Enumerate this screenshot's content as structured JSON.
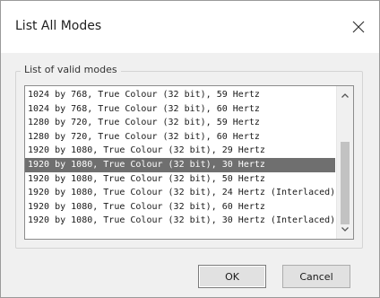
{
  "window": {
    "title": "List All Modes",
    "close_glyph": "✕"
  },
  "group": {
    "label": "List of valid modes"
  },
  "modes": [
    {
      "label": "1024 by 768, True Colour (32 bit), 59 Hertz",
      "selected": false
    },
    {
      "label": "1024 by 768, True Colour (32 bit), 60 Hertz",
      "selected": false
    },
    {
      "label": "1280 by 720, True Colour (32 bit), 59 Hertz",
      "selected": false
    },
    {
      "label": "1280 by 720, True Colour (32 bit), 60 Hertz",
      "selected": false
    },
    {
      "label": "1920 by 1080, True Colour (32 bit), 29 Hertz",
      "selected": false
    },
    {
      "label": "1920 by 1080, True Colour (32 bit), 30 Hertz",
      "selected": true
    },
    {
      "label": "1920 by 1080, True Colour (32 bit), 50 Hertz",
      "selected": false
    },
    {
      "label": "1920 by 1080, True Colour (32 bit), 24 Hertz (Interlaced)",
      "selected": false
    },
    {
      "label": "1920 by 1080, True Colour (32 bit), 60 Hertz",
      "selected": false
    },
    {
      "label": "1920 by 1080, True Colour (32 bit), 30 Hertz (Interlaced)",
      "selected": false
    }
  ],
  "buttons": {
    "ok": "OK",
    "cancel": "Cancel"
  },
  "colors": {
    "selection": "#6f6f6f",
    "dialog_bg": "#f0f0f0",
    "titlebar_bg": "#ffffff"
  },
  "icons": {
    "close": "close-icon",
    "scroll_up": "chevron-up-icon",
    "scroll_down": "chevron-down-icon"
  }
}
